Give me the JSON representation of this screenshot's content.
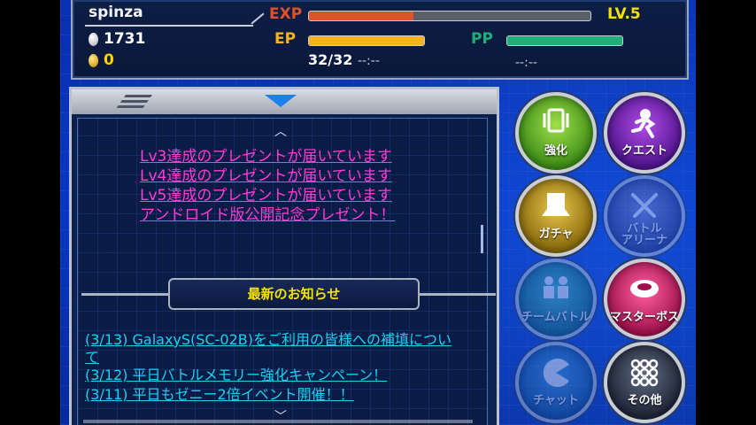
{
  "header": {
    "player_name": "spinza",
    "silver": "1731",
    "gold": "0",
    "exp_label": "EXP",
    "exp_fill": 0.37,
    "level": "LV.5",
    "ep_label": "EP",
    "ep_fill": 1.0,
    "ep_value": "32/32",
    "ep_timer": "--:--",
    "pp_label": "PP",
    "pp_fill": 1.0,
    "pp_timer": "--:--"
  },
  "presents": [
    "Lv3達成のプレゼントが届いています",
    "Lv4達成のプレゼントが届いています",
    "Lv5達成のプレゼントが届いています",
    "アンドロイド版公開記念プレゼント！"
  ],
  "news": {
    "title": "最新のお知らせ",
    "items": [
      "(3/13) GalaxyS(SC-02B)をご利用の皆様への補填につい",
      "て",
      "(3/12) 平日バトルメモリー強化キャンペーン！",
      "(3/11) 平日もゼニー2倍イベント開催！！"
    ]
  },
  "menu": {
    "enhance": "強化",
    "quest": "クエスト",
    "gacha": "ガチャ",
    "battle_arena_1": "バトル",
    "battle_arena_2": "アリーナ",
    "team_battle": "チームバトル",
    "master_boss": "マスターボス",
    "chat": "チャット",
    "other": "その他"
  },
  "colors": {
    "exp_bar": "#e0522a",
    "ep_bar": "#f7b21e",
    "pp_bar": "#1fb07a",
    "present_link": "#ff3cd6",
    "news_link": "#19d0f3",
    "level_text": "#f6e200"
  }
}
